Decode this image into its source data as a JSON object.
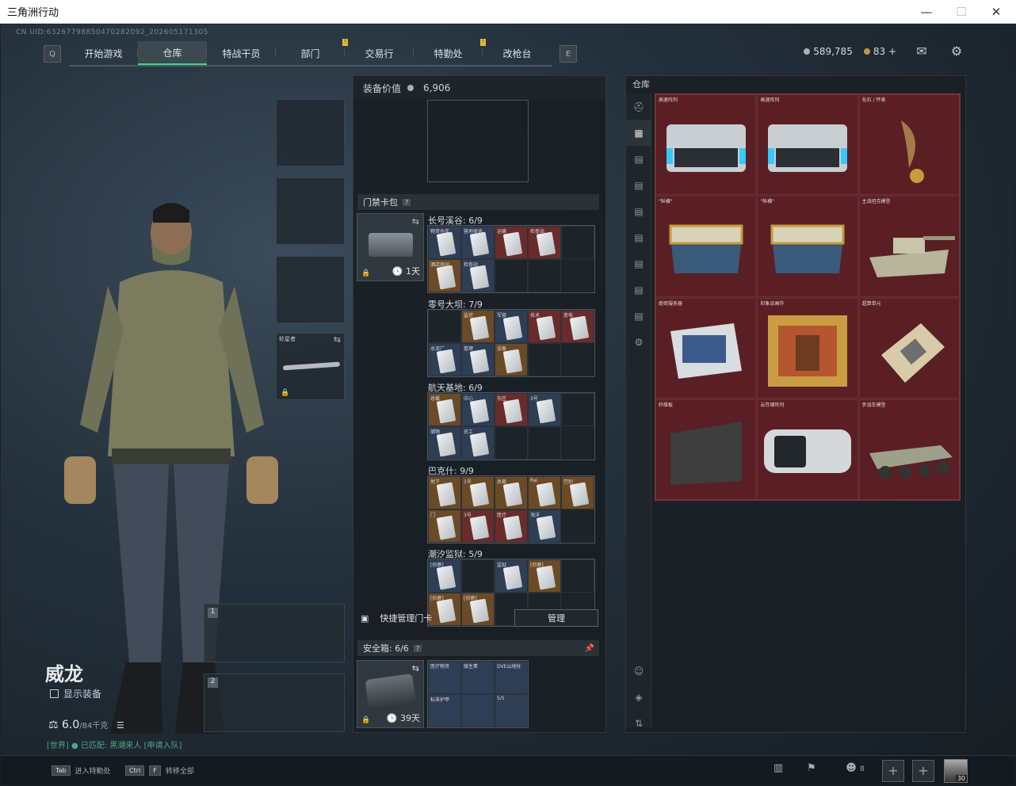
{
  "window": {
    "title": "三角洲行动"
  },
  "uid": "CN UID:63267798850470282092_202605171305",
  "nav": {
    "tabs": [
      {
        "label": "开始游戏",
        "active": false,
        "notif": false
      },
      {
        "label": "仓库",
        "active": true,
        "notif": false
      },
      {
        "label": "特战干员",
        "active": false,
        "notif": false
      },
      {
        "label": "部门",
        "active": false,
        "notif": true
      },
      {
        "label": "交易行",
        "active": false,
        "notif": false
      },
      {
        "label": "特勤处",
        "active": false,
        "notif": true
      },
      {
        "label": "改枪台",
        "active": false,
        "notif": false
      }
    ],
    "left_key": "Q",
    "right_key": "E"
  },
  "currency": {
    "silver": "589,785",
    "gold": "83",
    "plus": "+"
  },
  "character": {
    "name": "威龙",
    "show_equipment": "显示装备",
    "weight": "6.0",
    "weight_max": "/84千克",
    "chat": "[世界] ● 已匹配: 黑潮来人 [申请入队]"
  },
  "gun_slots": [
    {
      "num": "1"
    },
    {
      "num": "2"
    }
  ],
  "melee_slot": {
    "label": "轮星者"
  },
  "mid": {
    "equip_value_label": "装备价值",
    "equip_value": "6,906",
    "keycard_title": "门禁卡包",
    "keycard_timer": "1天",
    "groups": [
      {
        "label": "长号溪谷: 6/9",
        "cells": [
          {
            "t": "card blue",
            "k": "物资仓库"
          },
          {
            "t": "card blue",
            "k": "营地宿舍"
          },
          {
            "t": "card red",
            "k": "运输"
          },
          {
            "t": "card red",
            "k": "检查站"
          },
          {
            "t": "",
            "k": ""
          },
          {
            "t": "card gold",
            "k": "酒店房间"
          },
          {
            "t": "card blue",
            "k": "检查站"
          },
          {
            "t": "",
            "k": ""
          },
          {
            "t": "",
            "k": ""
          }
        ]
      },
      {
        "label": "零号大坝: 7/9",
        "cells": [
          {
            "t": "",
            "k": ""
          },
          {
            "t": "card gold",
            "k": "监控"
          },
          {
            "t": "card blue",
            "k": "军营"
          },
          {
            "t": "card red",
            "k": "技术"
          },
          {
            "t": "card red",
            "k": "变电"
          },
          {
            "t": "card blue",
            "k": "水泥厂"
          },
          {
            "t": "card blue",
            "k": "管理"
          },
          {
            "t": "card gold",
            "k": "设备"
          },
          {
            "t": "",
            "k": ""
          }
        ]
      },
      {
        "label": "航天基地: 6/9",
        "cells": [
          {
            "t": "card gold",
            "k": "总裁"
          },
          {
            "t": "card blue",
            "k": "中心"
          },
          {
            "t": "card red",
            "k": "东区"
          },
          {
            "t": "card blue",
            "k": "3号"
          },
          {
            "t": "",
            "k": ""
          },
          {
            "t": "card blue",
            "k": "储物"
          },
          {
            "t": "card blue",
            "k": "员工"
          },
          {
            "t": "",
            "k": ""
          },
          {
            "t": "",
            "k": ""
          }
        ]
      },
      {
        "label": "巴克什: 9/9",
        "cells": [
          {
            "t": "card gold",
            "k": "地下"
          },
          {
            "t": "card gold",
            "k": "1号"
          },
          {
            "t": "card gold",
            "k": "总裁"
          },
          {
            "t": "card gold",
            "k": "Rai"
          },
          {
            "t": "card gold",
            "k": "巴别"
          },
          {
            "t": "card gold",
            "k": "门"
          },
          {
            "t": "card red",
            "k": "3号"
          },
          {
            "t": "card red",
            "k": "医疗"
          },
          {
            "t": "card blue",
            "k": "海洋"
          }
        ]
      },
      {
        "label": "潮汐监狱: 5/9",
        "cells": [
          {
            "t": "card blue",
            "k": "[侦察]"
          },
          {
            "t": "",
            "k": ""
          },
          {
            "t": "card blue",
            "k": "监狱"
          },
          {
            "t": "card gold",
            "k": "[侦察]"
          },
          {
            "t": "",
            "k": ""
          },
          {
            "t": "card gold",
            "k": "[侦察]"
          },
          {
            "t": "card gold",
            "k": "[侦察]"
          },
          {
            "t": "",
            "k": ""
          },
          {
            "t": "",
            "k": ""
          }
        ]
      }
    ],
    "quick_manage": "快捷管理门卡",
    "manage_btn": "管理",
    "safebox_label": "安全箱:",
    "safebox_count": "6/6",
    "safebox_timer": "39天",
    "safe_items": [
      {
        "k": "医疗物资"
      },
      {
        "k": "维生素"
      },
      {
        "k": "DVE山地杖"
      },
      {
        "k": "标准护甲"
      },
      {
        "k": ""
      },
      {
        "k": "5/5"
      }
    ]
  },
  "warehouse": {
    "title": "仓库",
    "items": [
      {
        "label": "高速阵列",
        "shape": "server"
      },
      {
        "label": "高速阵列",
        "shape": "server"
      },
      {
        "label": "化石 / 怀表",
        "shape": "claw"
      },
      {
        "label": "\"纵横\"",
        "shape": "chess"
      },
      {
        "label": "\"纵横\"",
        "shape": "chess"
      },
      {
        "label": "主战坦克模型",
        "shape": "tank"
      },
      {
        "label": "绝密服务器",
        "shape": "rack"
      },
      {
        "label": "印象派画作",
        "shape": "painting"
      },
      {
        "label": "超算单元",
        "shape": "board"
      },
      {
        "label": "纤维板",
        "shape": "plate"
      },
      {
        "label": "云存储阵列",
        "shape": "storage"
      },
      {
        "label": "步战车模型",
        "shape": "ifv"
      }
    ]
  },
  "bottom": {
    "hint1_key": "Tab",
    "hint1": "进入特勤处",
    "hint2_key": "Ctrl",
    "hint2_key2": "F",
    "hint2": "转移全部",
    "friends": "8",
    "level": "30"
  }
}
